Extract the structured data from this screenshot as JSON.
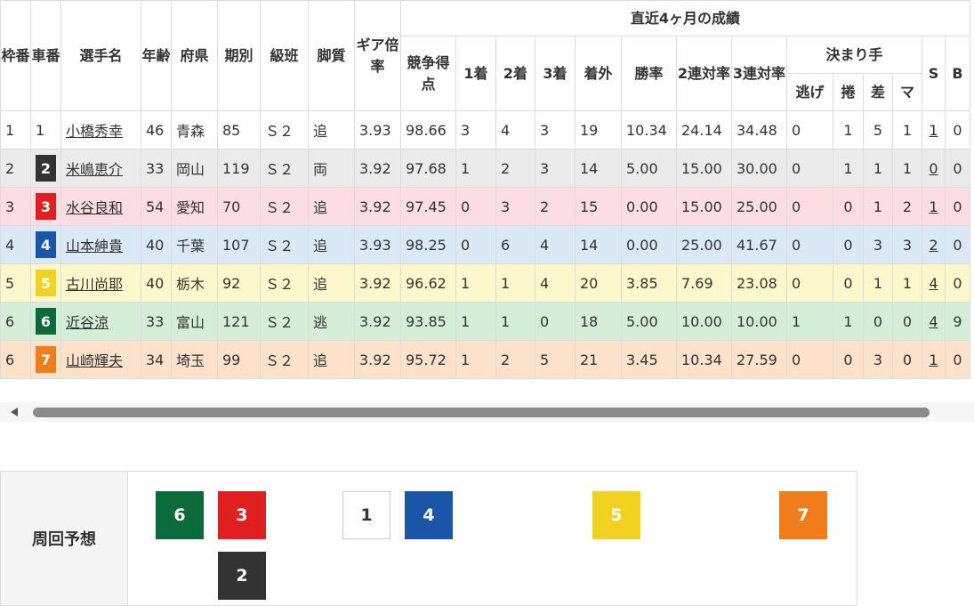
{
  "headers": {
    "waku": "枠番",
    "sha": "車番",
    "name": "選手名",
    "age": "年齢",
    "pref": "府県",
    "term": "期別",
    "class": "級班",
    "leg": "脚質",
    "gear": "ギア倍率",
    "recent": "直近4ヶ月の成績",
    "score": "競争得点",
    "first": "1着",
    "second": "2着",
    "third": "3着",
    "out": "着外",
    "win": "勝率",
    "quin2": "2連対率",
    "quin3": "3連対率",
    "kimarite": "決まり手",
    "nige": "逃げ",
    "makuri": "捲",
    "sashi": "差",
    "mark": "マ",
    "s": "S",
    "b": "B"
  },
  "colors": {
    "c1": "#ffffff",
    "c2": "#333333",
    "c3": "#e02020",
    "c4": "#1a56a8",
    "c5": "#f2d21e",
    "c6": "#0b6b3a",
    "c7": "#f07c1c"
  },
  "riders": [
    {
      "waku": "1",
      "sha": "1",
      "name": "小橋秀幸",
      "age": "46",
      "pref": "青森",
      "term": "85",
      "cls": "Ｓ２",
      "leg": "追",
      "gear": "3.93",
      "score": "98.66",
      "f1": "3",
      "f2": "4",
      "f3": "3",
      "out": "19",
      "win": "10.34",
      "q2": "24.14",
      "q3": "34.48",
      "nige": "0",
      "makuri": "1",
      "sashi": "5",
      "mark": "1",
      "s": "1",
      "b": "0"
    },
    {
      "waku": "2",
      "sha": "2",
      "name": "米嶋恵介",
      "age": "33",
      "pref": "岡山",
      "term": "119",
      "cls": "Ｓ２",
      "leg": "両",
      "gear": "3.92",
      "score": "97.68",
      "f1": "1",
      "f2": "2",
      "f3": "3",
      "out": "14",
      "win": "5.00",
      "q2": "15.00",
      "q3": "30.00",
      "nige": "0",
      "makuri": "1",
      "sashi": "1",
      "mark": "1",
      "s": "0",
      "b": "0"
    },
    {
      "waku": "3",
      "sha": "3",
      "name": "水谷良和",
      "age": "54",
      "pref": "愛知",
      "term": "70",
      "cls": "Ｓ２",
      "leg": "追",
      "gear": "3.92",
      "score": "97.45",
      "f1": "0",
      "f2": "3",
      "f3": "2",
      "out": "15",
      "win": "0.00",
      "q2": "15.00",
      "q3": "25.00",
      "nige": "0",
      "makuri": "0",
      "sashi": "1",
      "mark": "2",
      "s": "1",
      "b": "0"
    },
    {
      "waku": "4",
      "sha": "4",
      "name": "山本紳貴",
      "age": "40",
      "pref": "千葉",
      "term": "107",
      "cls": "Ｓ２",
      "leg": "追",
      "gear": "3.93",
      "score": "98.25",
      "f1": "0",
      "f2": "6",
      "f3": "4",
      "out": "14",
      "win": "0.00",
      "q2": "25.00",
      "q3": "41.67",
      "nige": "0",
      "makuri": "0",
      "sashi": "3",
      "mark": "3",
      "s": "2",
      "b": "0"
    },
    {
      "waku": "5",
      "sha": "5",
      "name": "古川尚耶",
      "age": "40",
      "pref": "栃木",
      "term": "92",
      "cls": "Ｓ２",
      "leg": "追",
      "gear": "3.92",
      "score": "96.62",
      "f1": "1",
      "f2": "1",
      "f3": "4",
      "out": "20",
      "win": "3.85",
      "q2": "7.69",
      "q3": "23.08",
      "nige": "0",
      "makuri": "0",
      "sashi": "1",
      "mark": "1",
      "s": "4",
      "b": "0"
    },
    {
      "waku": "6",
      "sha": "6",
      "name": "近谷涼",
      "age": "33",
      "pref": "富山",
      "term": "121",
      "cls": "Ｓ２",
      "leg": "逃",
      "gear": "3.92",
      "score": "93.85",
      "f1": "1",
      "f2": "1",
      "f3": "0",
      "out": "18",
      "win": "5.00",
      "q2": "10.00",
      "q3": "10.00",
      "nige": "1",
      "makuri": "1",
      "sashi": "0",
      "mark": "0",
      "s": "4",
      "b": "9"
    },
    {
      "waku": "6",
      "sha": "7",
      "name": "山崎輝夫",
      "age": "34",
      "pref": "埼玉",
      "term": "99",
      "cls": "Ｓ２",
      "leg": "追",
      "gear": "3.92",
      "score": "95.72",
      "f1": "1",
      "f2": "2",
      "f3": "5",
      "out": "21",
      "win": "3.45",
      "q2": "10.34",
      "q3": "27.59",
      "nige": "0",
      "makuri": "0",
      "sashi": "3",
      "mark": "0",
      "s": "1",
      "b": "0"
    }
  ],
  "forecast": {
    "label": "周回予想",
    "boxes": [
      "6",
      "3",
      "1",
      "4",
      "5",
      "7",
      "2"
    ]
  }
}
